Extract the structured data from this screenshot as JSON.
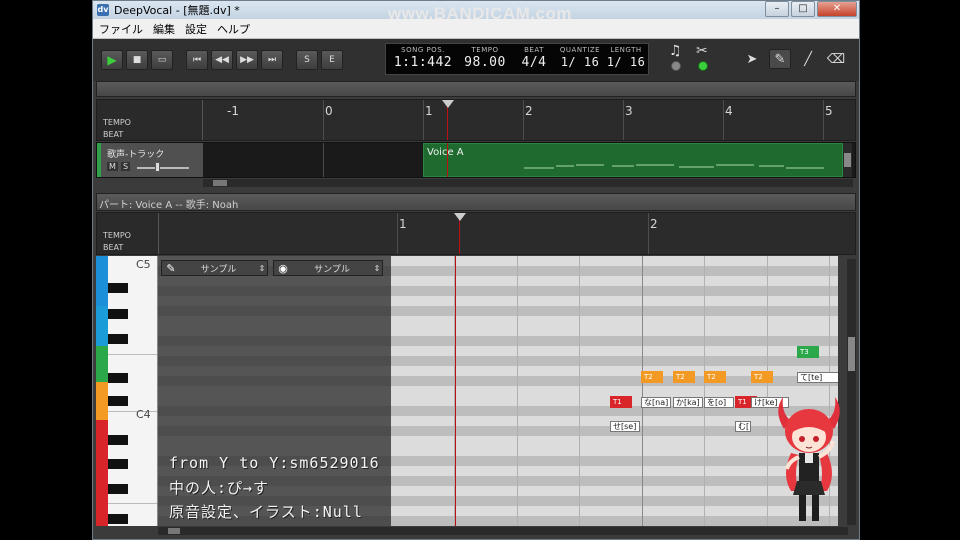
{
  "watermark": "www.BANDICAM.com",
  "window": {
    "title": "DeepVocal - [無題.dv] *",
    "icon_text": "dv",
    "controls": {
      "minimize": "–",
      "maximize": "□",
      "close": "✕"
    }
  },
  "menu": [
    "ファイル",
    "編集",
    "設定",
    "ヘルプ"
  ],
  "toolbar": {
    "play": "▶",
    "stop": "■",
    "loop": "▭",
    "rewind_start": "⏮",
    "rewind": "◀◀",
    "forward": "▶▶",
    "forward_end": "⏭",
    "metronome_s": "S",
    "metronome_e": "E"
  },
  "lcd": {
    "song_pos_label": "SONG POS.",
    "song_pos": "1:1:442",
    "tempo_label": "TEMPO",
    "tempo": "98.00",
    "beat_label": "BEAT",
    "beat": "4/4",
    "quantize_label": "QUANTIZE",
    "quantize": "1/ 16",
    "length_label": "LENGTH",
    "length": "1/ 16"
  },
  "ruler_labels": {
    "tempo": "TEMPO",
    "beat": "BEAT"
  },
  "top_bars": [
    "-1",
    "0",
    "1",
    "2",
    "3",
    "4",
    "5"
  ],
  "track": {
    "name": "歌声-トラック",
    "mute": "M",
    "solo": "S",
    "part_name": "Voice A"
  },
  "part_header": "パート: Voice A  --  歌手: Noah",
  "piano_bars": [
    "1",
    "2"
  ],
  "piano_keys": {
    "c5": "C5",
    "c4": "C4"
  },
  "selectors": {
    "pencil_select": "サンプル",
    "eye_select": "サンプル"
  },
  "notes": [
    {
      "flag": "T1",
      "lyric": "せ[se]"
    },
    {
      "flag": "T2",
      "lyric": "な[na]"
    },
    {
      "flag": "T2",
      "lyric": "か[ka]"
    },
    {
      "flag": "T2",
      "lyric": "を[o]"
    },
    {
      "flag": "T1",
      "lyric": "む["
    },
    {
      "flag": "T2",
      "lyric": "け[ke]"
    },
    {
      "flag": "T3",
      "lyric": "て[te]"
    }
  ],
  "credits": [
    "from Y to Y:sm6529016",
    "中の人:ぴ→す",
    "原音設定、イラスト:Null"
  ],
  "colors": {
    "t1": "#d8252a",
    "t2": "#f39a24",
    "t3": "#2aa84a",
    "play_green": "#3ccf3c",
    "playhead": "#b11111"
  }
}
